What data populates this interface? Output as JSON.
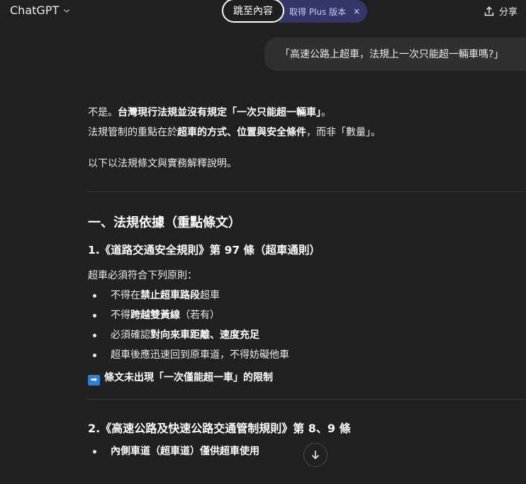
{
  "header": {
    "app_name": "ChatGPT",
    "skip_link": "跳至內容",
    "plus_promo": "取得 Plus 版本",
    "plus_close": "×",
    "share_label": "分享"
  },
  "user_message": "「高速公路上超車，法規上一次只能超一輛車嗎?」",
  "answer": {
    "intro_1_plain": "不是。",
    "intro_1_bold": "台灣現行法規並沒有規定「一次只能超一輛車」",
    "intro_1_end": "。",
    "intro_2_a": "法規管制的重點在於",
    "intro_2_bold": "超車的方式、位置與安全條件",
    "intro_2_b": "，而非「數量」。",
    "intro_3": "以下以法規條文與實務解釋說明。",
    "section_1_title": "一、法規依據（重點條文）",
    "sub_1_title": "1.《道路交通安全規則》第 97 條（超車通則）",
    "sub_1_lead": "超車必須符合下列原則：",
    "sub_1_items": [
      {
        "a": "不得在",
        "b": "禁止超車路段",
        "c": "超車"
      },
      {
        "a": "不得",
        "b": "跨越雙黃線",
        "c": "（若有）"
      },
      {
        "a": "必須確認",
        "b": "對向來車距離、速度充足",
        "c": ""
      },
      {
        "a": "超車後應迅速回到原車道，不得妨礙他車",
        "b": "",
        "c": ""
      }
    ],
    "sub_1_note": "條文未出現「一次僅能超一車」的限制",
    "sub_2_title": "2.《高速公路及快速公路交通管制規則》第 8、9 條",
    "sub_2_items": [
      {
        "b": "內側車道（超車道）僅供超車使用"
      }
    ]
  }
}
